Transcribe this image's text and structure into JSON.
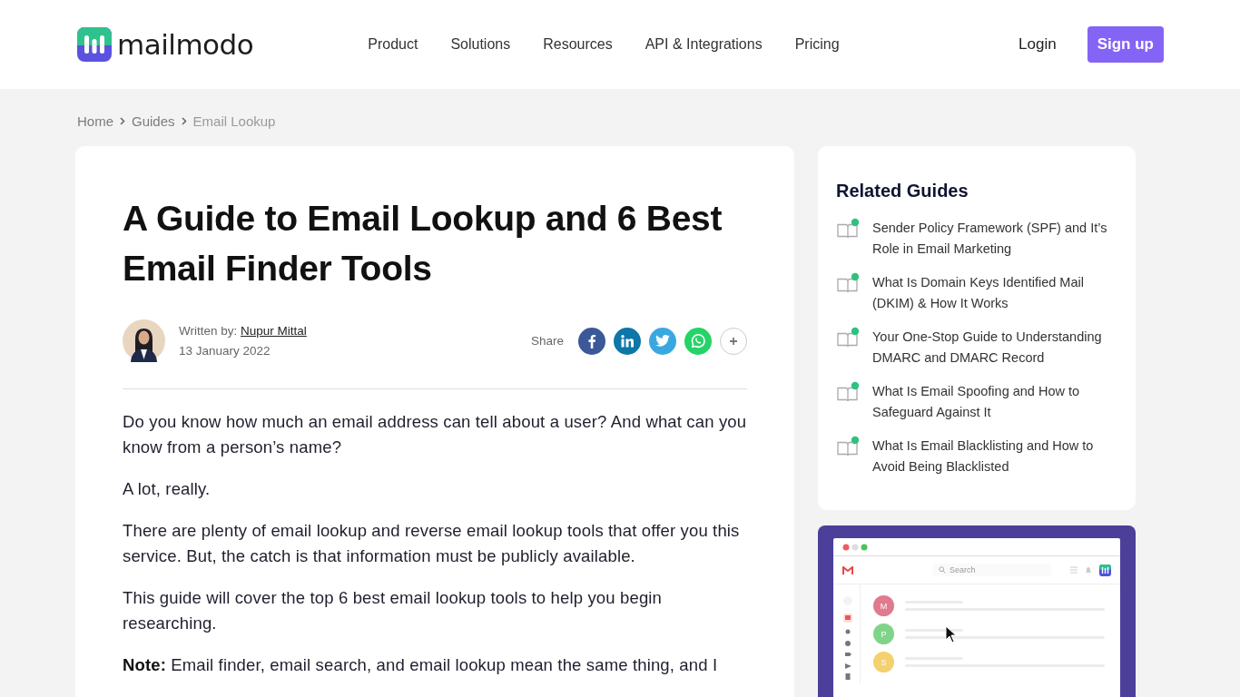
{
  "header": {
    "logo": "mailmodo",
    "nav": [
      {
        "label": "Product"
      },
      {
        "label": "Solutions"
      },
      {
        "label": "Resources"
      },
      {
        "label": "API & Integrations"
      },
      {
        "label": "Pricing"
      }
    ],
    "login": "Login",
    "signup": "Sign up"
  },
  "breadcrumb": [
    {
      "label": "Home",
      "current": false
    },
    {
      "label": "Guides",
      "current": false
    },
    {
      "label": "Email Lookup",
      "current": true
    }
  ],
  "article": {
    "title": "A Guide to Email Lookup and 6 Best Email Finder Tools",
    "author_label": "Written by:",
    "author": "Nupur Mittal",
    "date": "13 January 2022",
    "share_label": "Share",
    "share": [
      {
        "kind": "facebook",
        "color": "#3b5998"
      },
      {
        "kind": "linkedin",
        "color": "#0e76a8"
      },
      {
        "kind": "twitter",
        "color": "#3aa8e0"
      },
      {
        "kind": "whatsapp",
        "color": "#25d366"
      },
      {
        "kind": "more",
        "color": "#ffffff"
      }
    ],
    "paragraphs": [
      "Do you know how much an email address can tell about a user? And what can you know from a person’s name?",
      "A lot, really.",
      "There are plenty of email lookup and reverse email lookup tools that offer you this service. But, the catch is that information must be publicly available.",
      "This guide will cover the top 6 best email lookup tools to help you begin researching.",
      "**Note:** Email finder, email search, and email lookup mean the same thing, and I"
    ]
  },
  "sidebar": {
    "title": "Related Guides",
    "guides": [
      {
        "label": "Sender Policy Framework (SPF) and It’s Role in Email Marketing"
      },
      {
        "label": "What Is Domain Keys Identified Mail (DKIM) & How It Works"
      },
      {
        "label": "Your One-Stop Guide to Understanding DMARC and DMARC Record"
      },
      {
        "label": "What Is Email Spoofing and How to Safeguard Against It"
      },
      {
        "label": "What Is Email Blacklisting and How to Avoid Being Blacklisted"
      }
    ]
  },
  "promo": {
    "search_placeholder": "Search",
    "avatars": [
      {
        "letter": "M",
        "color": "#e07a8e"
      },
      {
        "letter": "P",
        "color": "#7fd48a"
      },
      {
        "letter": "S",
        "color": "#f4d06f"
      }
    ]
  }
}
